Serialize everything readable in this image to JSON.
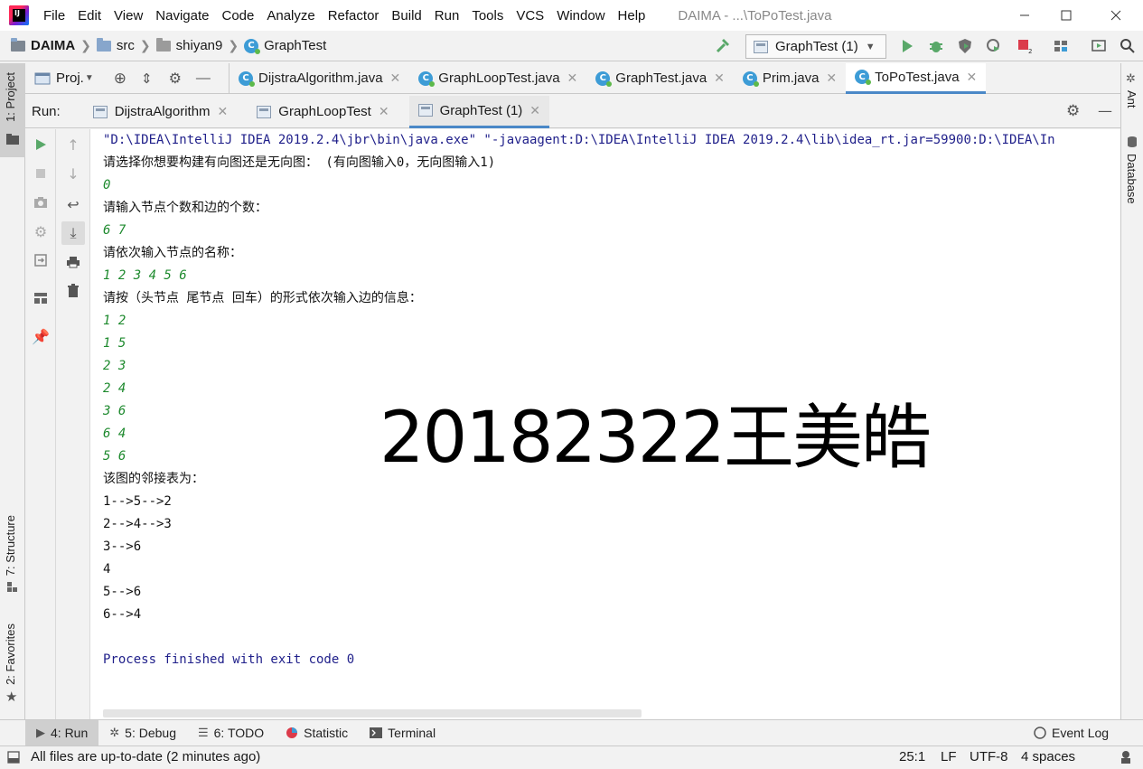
{
  "menu": {
    "logo_text": "IJ",
    "items": [
      "File",
      "Edit",
      "View",
      "Navigate",
      "Code",
      "Analyze",
      "Refactor",
      "Build",
      "Run",
      "Tools",
      "VCS",
      "Window",
      "Help"
    ],
    "window_title": "DAIMA - ...\\ToPoTest.java"
  },
  "nav": {
    "crumbs": [
      "DAIMA",
      "src",
      "shiyan9",
      "GraphTest"
    ],
    "run_config": "GraphTest (1)",
    "class_letter": "C"
  },
  "editor": {
    "project_label": "Proj.",
    "tabs": [
      "DijstraAlgorithm.java",
      "GraphLoopTest.java",
      "GraphTest.java",
      "Prim.java",
      "ToPoTest.java"
    ],
    "active_tab": 4
  },
  "run": {
    "label": "Run:",
    "tabs": [
      "DijstraAlgorithm",
      "GraphLoopTest",
      "GraphTest (1)"
    ],
    "active_tab": 2
  },
  "tool_strips": {
    "left": [
      "1: Project",
      "7: Structure",
      "2: Favorites"
    ],
    "right": [
      "Ant",
      "Database"
    ]
  },
  "console": {
    "lines": [
      {
        "text": "\"D:\\IDEA\\IntelliJ IDEA 2019.2.4\\jbr\\bin\\java.exe\" \"-javaagent:D:\\IDEA\\IntelliJ IDEA 2019.2.4\\lib\\idea_rt.jar=59900:D:\\IDEA\\In",
        "kind": "cmd"
      },
      {
        "text": "请选择你想要构建有向图还是无向图： (有向图输入0，无向图输入1)",
        "kind": "out"
      },
      {
        "text": "0",
        "kind": "input"
      },
      {
        "text": "请输入节点个数和边的个数：",
        "kind": "out"
      },
      {
        "text": "6 7",
        "kind": "input"
      },
      {
        "text": "请依次输入节点的名称：",
        "kind": "out"
      },
      {
        "text": "1 2 3 4 5 6",
        "kind": "input"
      },
      {
        "text": "请按（头节点 尾节点 回车）的形式依次输入边的信息：",
        "kind": "out"
      },
      {
        "text": "1 2",
        "kind": "input"
      },
      {
        "text": "1 5",
        "kind": "input"
      },
      {
        "text": "2 3",
        "kind": "input"
      },
      {
        "text": "2 4",
        "kind": "input"
      },
      {
        "text": "3 6",
        "kind": "input"
      },
      {
        "text": "6 4",
        "kind": "input"
      },
      {
        "text": "5 6",
        "kind": "input"
      },
      {
        "text": "该图的邻接表为：",
        "kind": "out"
      },
      {
        "text": "1-->5-->2",
        "kind": "out"
      },
      {
        "text": "2-->4-->3",
        "kind": "out"
      },
      {
        "text": "3-->6",
        "kind": "out"
      },
      {
        "text": "4",
        "kind": "out"
      },
      {
        "text": "5-->6",
        "kind": "out"
      },
      {
        "text": "6-->4",
        "kind": "out"
      },
      {
        "text": "",
        "kind": "out"
      },
      {
        "text": "Process finished with exit code 0",
        "kind": "cmd"
      }
    ],
    "watermark": "20182322王美皓"
  },
  "bottom_tabs": [
    {
      "label": "4: Run",
      "icon": "run-icon"
    },
    {
      "label": "5: Debug",
      "icon": "debug-icon"
    },
    {
      "label": "6: TODO",
      "icon": "todo-icon"
    },
    {
      "label": "Statistic",
      "icon": "statistic-icon"
    },
    {
      "label": "Terminal",
      "icon": "terminal-icon"
    }
  ],
  "event_log": "Event Log",
  "status": {
    "message": "All files are up-to-date (2 minutes ago)",
    "position": "25:1",
    "line_sep": "LF",
    "encoding": "UTF-8",
    "indent": "4 spaces"
  },
  "colors": {
    "accent": "#4a88c7",
    "run_green": "#59a869",
    "console_cmd": "#1f1f8a",
    "console_input": "#1e8a2e"
  }
}
